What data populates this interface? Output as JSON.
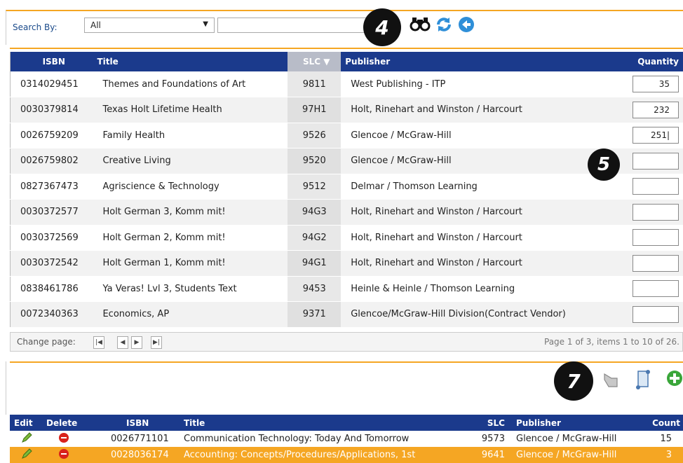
{
  "search": {
    "label": "Search By:",
    "selected": "All",
    "value": ""
  },
  "badges": {
    "b4": "4",
    "b5": "5",
    "b7": "7"
  },
  "grid": {
    "columns": {
      "isbn": "ISBN",
      "title": "Title",
      "slc": "SLC ▼",
      "publisher": "Publisher",
      "quantity": "Quantity"
    },
    "rows": [
      {
        "isbn": "0314029451",
        "title": "Themes and Foundations of Art",
        "slc": "9811",
        "publisher": "West Publishing - ITP",
        "quantity": "35"
      },
      {
        "isbn": "0030379814",
        "title": "Texas Holt Lifetime Health",
        "slc": "97H1",
        "publisher": "Holt, Rinehart and Winston / Harcourt",
        "quantity": "232"
      },
      {
        "isbn": "0026759209",
        "title": "Family Health",
        "slc": "9526",
        "publisher": "Glencoe / McGraw-Hill",
        "quantity": "251|"
      },
      {
        "isbn": "0026759802",
        "title": "Creative Living",
        "slc": "9520",
        "publisher": "Glencoe / McGraw-Hill",
        "quantity": ""
      },
      {
        "isbn": "0827367473",
        "title": "Agriscience & Technology",
        "slc": "9512",
        "publisher": "Delmar / Thomson Learning",
        "quantity": ""
      },
      {
        "isbn": "0030372577",
        "title": "Holt German 3, Komm mit!",
        "slc": "94G3",
        "publisher": "Holt, Rinehart and Winston / Harcourt",
        "quantity": ""
      },
      {
        "isbn": "0030372569",
        "title": "Holt German 2, Komm mit!",
        "slc": "94G2",
        "publisher": "Holt, Rinehart and Winston / Harcourt",
        "quantity": ""
      },
      {
        "isbn": "0030372542",
        "title": "Holt German 1, Komm mit!",
        "slc": "94G1",
        "publisher": "Holt, Rinehart and Winston / Harcourt",
        "quantity": ""
      },
      {
        "isbn": "0838461786",
        "title": "Ya Veras! Lvl 3, Students Text",
        "slc": "9453",
        "publisher": "Heinle & Heinle / Thomson Learning",
        "quantity": ""
      },
      {
        "isbn": "0072340363",
        "title": "Economics, AP",
        "slc": "9371",
        "publisher": "Glencoe/McGraw-Hill Division(Contract Vendor)",
        "quantity": ""
      }
    ]
  },
  "pager": {
    "label": "Change page:",
    "status": "Page 1 of 3, items 1 to 10 of 26."
  },
  "grid2": {
    "columns": {
      "edit": "Edit",
      "delete": "Delete",
      "isbn": "ISBN",
      "title": "Title",
      "slc": "SLC",
      "publisher": "Publisher",
      "count": "Count"
    },
    "rows": [
      {
        "isbn": "0026771101",
        "title": "Communication Technology: Today And Tomorrow",
        "slc": "9573",
        "publisher": "Glencoe / McGraw-Hill",
        "count": "15"
      },
      {
        "isbn": "0028036174",
        "title": "Accounting: Concepts/Procedures/Applications, 1st",
        "slc": "9641",
        "publisher": "Glencoe / McGraw-Hill",
        "count": "3"
      }
    ]
  },
  "colors": {
    "accent": "#f5a623",
    "header": "#1b3a8c"
  }
}
